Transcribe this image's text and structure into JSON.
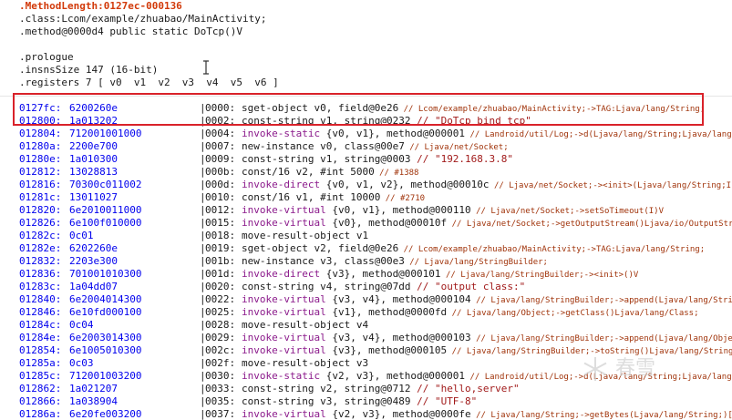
{
  "header": {
    "method_length": ".MethodLength:0127ec-000136",
    "class_line": ".class:Lcom/example/zhuabao/MainActivity;",
    "method_line": ".method@0000d4 public static DoTcp()V",
    "prologue": ".prologue",
    "insns_size": ".insnsSize 147 (16-bit)",
    "registers": ".registers 7 [ v0  v1  v2  v3  v4  v5  v6 ]"
  },
  "rows": [
    {
      "addr": "0127fc:",
      "bytes": "6200260e",
      "off": "0000:",
      "op": "sget-object",
      "invoke": false,
      "ops": " v0, field@0e26",
      "str": "",
      "cmt": " // Lcom/example/zhuabao/MainActivity;->TAG:Ljava/lang/String;"
    },
    {
      "addr": "012800:",
      "bytes": "1a013202",
      "off": "0002:",
      "op": "const-string",
      "invoke": false,
      "ops": " v1, string@0232",
      "str": " // \"DoTcp bind tcp\"",
      "cmt": ""
    },
    {
      "addr": "012804:",
      "bytes": "712001001000",
      "off": "0004:",
      "op": "invoke-static",
      "invoke": true,
      "ops": " {v0, v1}, method@000001",
      "str": "",
      "cmt": " // Landroid/util/Log;->d(Ljava/lang/String;Ljava/lang/String;)I"
    },
    {
      "addr": "01280a:",
      "bytes": "2200e700",
      "off": "0007:",
      "op": "new-instance",
      "invoke": false,
      "ops": " v0, class@00e7",
      "str": "",
      "cmt": " // Ljava/net/Socket;"
    },
    {
      "addr": "01280e:",
      "bytes": "1a010300",
      "off": "0009:",
      "op": "const-string",
      "invoke": false,
      "ops": " v1, string@0003",
      "str": " // \"192.168.3.8\"",
      "cmt": ""
    },
    {
      "addr": "012812:",
      "bytes": "13028813",
      "off": "000b:",
      "op": "const/16",
      "invoke": false,
      "ops": " v2, #int 5000",
      "str": "",
      "cmt": " // #1388"
    },
    {
      "addr": "012816:",
      "bytes": "70300c011002",
      "off": "000d:",
      "op": "invoke-direct",
      "invoke": true,
      "ops": " {v0, v1, v2}, method@00010c",
      "str": "",
      "cmt": " // Ljava/net/Socket;-><init>(Ljava/lang/String;I)V"
    },
    {
      "addr": "01281c:",
      "bytes": "13011027",
      "off": "0010:",
      "op": "const/16",
      "invoke": false,
      "ops": " v1, #int 10000",
      "str": "",
      "cmt": " // #2710"
    },
    {
      "addr": "012820:",
      "bytes": "6e2010011000",
      "off": "0012:",
      "op": "invoke-virtual",
      "invoke": true,
      "ops": " {v0, v1}, method@000110",
      "str": "",
      "cmt": " // Ljava/net/Socket;->setSoTimeout(I)V"
    },
    {
      "addr": "012826:",
      "bytes": "6e100f010000",
      "off": "0015:",
      "op": "invoke-virtual",
      "invoke": true,
      "ops": " {v0}, method@00010f",
      "str": "",
      "cmt": " // Ljava/net/Socket;->getOutputStream()Ljava/io/OutputStream;"
    },
    {
      "addr": "01282c:",
      "bytes": "0c01",
      "off": "0018:",
      "op": "move-result-object",
      "invoke": false,
      "ops": " v1",
      "str": "",
      "cmt": ""
    },
    {
      "addr": "01282e:",
      "bytes": "6202260e",
      "off": "0019:",
      "op": "sget-object",
      "invoke": false,
      "ops": " v2, field@0e26",
      "str": "",
      "cmt": " // Lcom/example/zhuabao/MainActivity;->TAG:Ljava/lang/String;"
    },
    {
      "addr": "012832:",
      "bytes": "2203e300",
      "off": "001b:",
      "op": "new-instance",
      "invoke": false,
      "ops": " v3, class@00e3",
      "str": "",
      "cmt": " // Ljava/lang/StringBuilder;"
    },
    {
      "addr": "012836:",
      "bytes": "701001010300",
      "off": "001d:",
      "op": "invoke-direct",
      "invoke": true,
      "ops": " {v3}, method@000101",
      "str": "",
      "cmt": " // Ljava/lang/StringBuilder;-><init>()V"
    },
    {
      "addr": "01283c:",
      "bytes": "1a04dd07",
      "off": "0020:",
      "op": "const-string",
      "invoke": false,
      "ops": " v4, string@07dd",
      "str": " // \"output class:\"",
      "cmt": ""
    },
    {
      "addr": "012840:",
      "bytes": "6e2004014300",
      "off": "0022:",
      "op": "invoke-virtual",
      "invoke": true,
      "ops": " {v3, v4}, method@000104",
      "str": "",
      "cmt": " // Ljava/lang/StringBuilder;->append(Ljava/lang/String;)Ljava/lang/StringBuilder;"
    },
    {
      "addr": "012846:",
      "bytes": "6e10fd000100",
      "off": "0025:",
      "op": "invoke-virtual",
      "invoke": true,
      "ops": " {v1}, method@0000fd",
      "str": "",
      "cmt": " // Ljava/lang/Object;->getClass()Ljava/lang/Class;"
    },
    {
      "addr": "01284c:",
      "bytes": "0c04",
      "off": "0028:",
      "op": "move-result-object",
      "invoke": false,
      "ops": " v4",
      "str": "",
      "cmt": ""
    },
    {
      "addr": "01284e:",
      "bytes": "6e2003014300",
      "off": "0029:",
      "op": "invoke-virtual",
      "invoke": true,
      "ops": " {v3, v4}, method@000103",
      "str": "",
      "cmt": " // Ljava/lang/StringBuilder;->append(Ljava/lang/Object;)Ljava/lang/StringBuilder;"
    },
    {
      "addr": "012854:",
      "bytes": "6e1005010300",
      "off": "002c:",
      "op": "invoke-virtual",
      "invoke": true,
      "ops": " {v3}, method@000105",
      "str": "",
      "cmt": " // Ljava/lang/StringBuilder;->toString()Ljava/lang/String;"
    },
    {
      "addr": "01285a:",
      "bytes": "0c03",
      "off": "002f:",
      "op": "move-result-object",
      "invoke": false,
      "ops": " v3",
      "str": "",
      "cmt": ""
    },
    {
      "addr": "01285c:",
      "bytes": "712001003200",
      "off": "0030:",
      "op": "invoke-static",
      "invoke": true,
      "ops": " {v2, v3}, method@000001",
      "str": "",
      "cmt": " // Landroid/util/Log;->d(Ljava/lang/String;Ljava/lang/String;)I"
    },
    {
      "addr": "012862:",
      "bytes": "1a021207",
      "off": "0033:",
      "op": "const-string",
      "invoke": false,
      "ops": " v2, string@0712",
      "str": " // \"hello,server\"",
      "cmt": ""
    },
    {
      "addr": "012866:",
      "bytes": "1a038904",
      "off": "0035:",
      "op": "const-string",
      "invoke": false,
      "ops": " v3, string@0489",
      "str": " // \"UTF-8\"",
      "cmt": ""
    },
    {
      "addr": "01286a:",
      "bytes": "6e20fe003200",
      "off": "0037:",
      "op": "invoke-virtual",
      "invoke": true,
      "ops": " {v2, v3}, method@0000fe",
      "str": "",
      "cmt": " // Ljava/lang/String;->getBytes(Ljava/lang/String;)[B"
    }
  ],
  "watermark": "春雪",
  "colors": {
    "address": "#0000ee",
    "invoke": "#8b1a8b",
    "string": "#a11a1a",
    "comment": "#a0330a",
    "method_length": "#d23a0a",
    "highlight_box": "#d9222a"
  }
}
